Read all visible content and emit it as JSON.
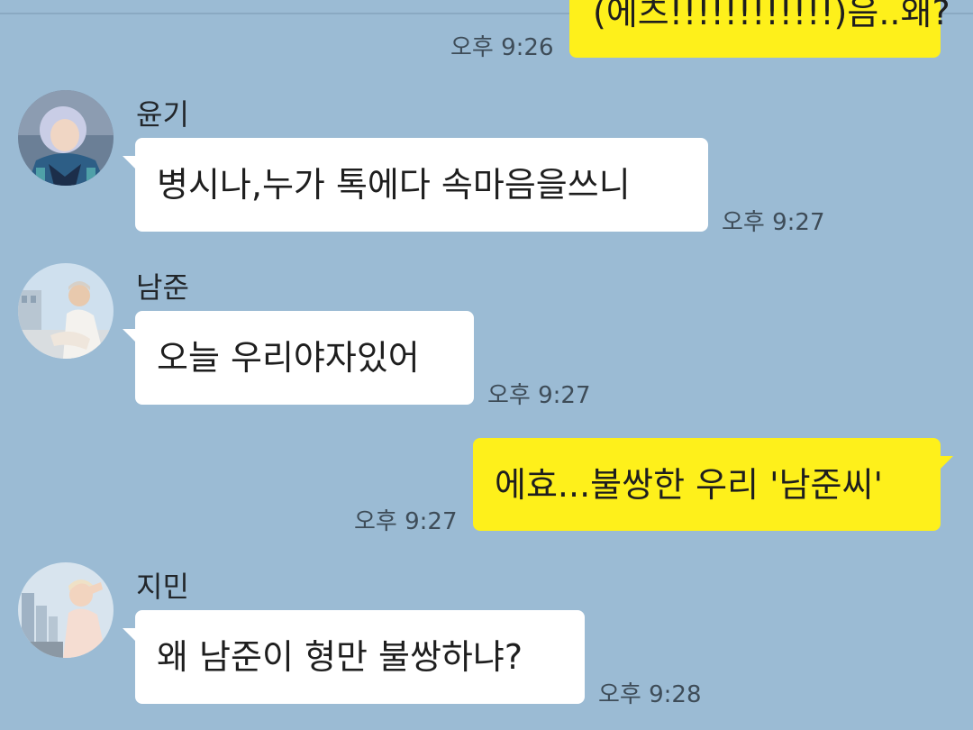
{
  "messages": [
    {
      "id": "m0",
      "side": "out",
      "text": "(에츠!!!!!!!!!!!!)음..왜?",
      "time": "오후 9:26"
    },
    {
      "id": "m1",
      "side": "in",
      "sender": "윤기",
      "text": "병시나,누가 톡에다 속마음을쓰니",
      "time": "오후 9:27"
    },
    {
      "id": "m2",
      "side": "in",
      "sender": "남준",
      "text": "오늘 우리야자있어",
      "time": "오후 9:27"
    },
    {
      "id": "m3",
      "side": "out",
      "text": "에효...불쌍한 우리 '남준씨'",
      "time": "오후 9:27"
    },
    {
      "id": "m4",
      "side": "in",
      "sender": "지민",
      "text": "왜 남준이 형만 불쌍하냐?",
      "time": "오후 9:28"
    }
  ],
  "colors": {
    "background": "#9bbbd4",
    "incoming_bubble": "#ffffff",
    "outgoing_bubble": "#fef01b"
  }
}
